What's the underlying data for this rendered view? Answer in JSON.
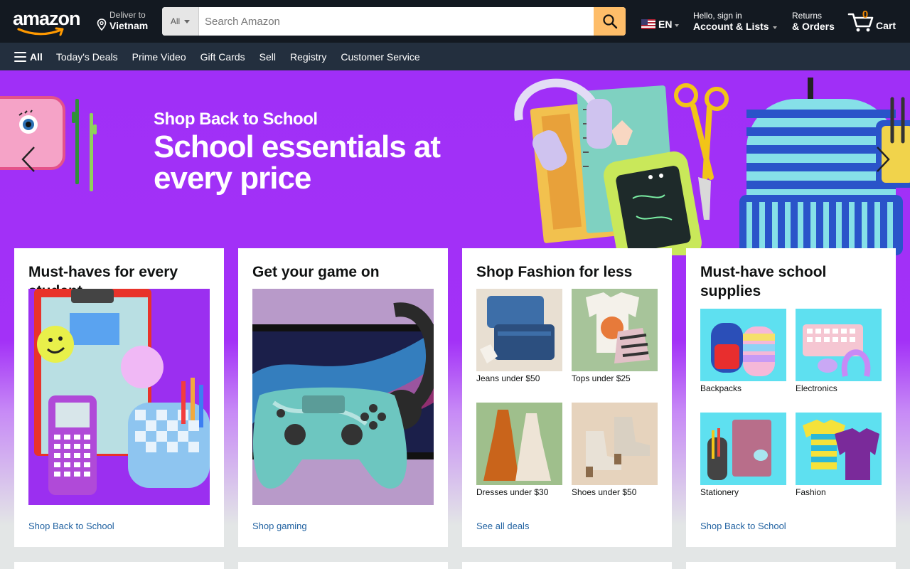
{
  "header": {
    "logo_text": "amazon",
    "deliver": {
      "line1": "Deliver to",
      "line2": "Vietnam"
    },
    "search": {
      "category": "All",
      "placeholder": "Search Amazon"
    },
    "language": {
      "code": "EN"
    },
    "account": {
      "line1": "Hello, sign in",
      "line2": "Account & Lists"
    },
    "returns": {
      "line1": "Returns",
      "line2": "& Orders"
    },
    "cart": {
      "count": "0",
      "label": "Cart"
    }
  },
  "subnav": {
    "all_label": "All",
    "items": [
      "Today's Deals",
      "Prime Video",
      "Gift Cards",
      "Sell",
      "Registry",
      "Customer Service"
    ]
  },
  "hero": {
    "kicker": "Shop Back to School",
    "headline": "School essentials at every price"
  },
  "cards": [
    {
      "title": "Must-haves for every student",
      "link": "Shop Back to School"
    },
    {
      "title": "Get your game on",
      "link": "Shop gaming"
    },
    {
      "title": "Shop Fashion for less",
      "link": "See all deals",
      "tiles": [
        "Jeans under $50",
        "Tops under $25",
        "Dresses under $30",
        "Shoes under $50"
      ]
    },
    {
      "title": "Must-have school supplies",
      "link": "Shop Back to School",
      "tiles": [
        "Backpacks",
        "Electronics",
        "Stationery",
        "Fashion"
      ]
    }
  ],
  "colors": {
    "nav_bg": "#131921",
    "subnav_bg": "#232f3e",
    "search_button": "#febd69",
    "hero_purple": "#a331f7",
    "link_blue": "#2162a1",
    "cart_count": "#f08804"
  }
}
